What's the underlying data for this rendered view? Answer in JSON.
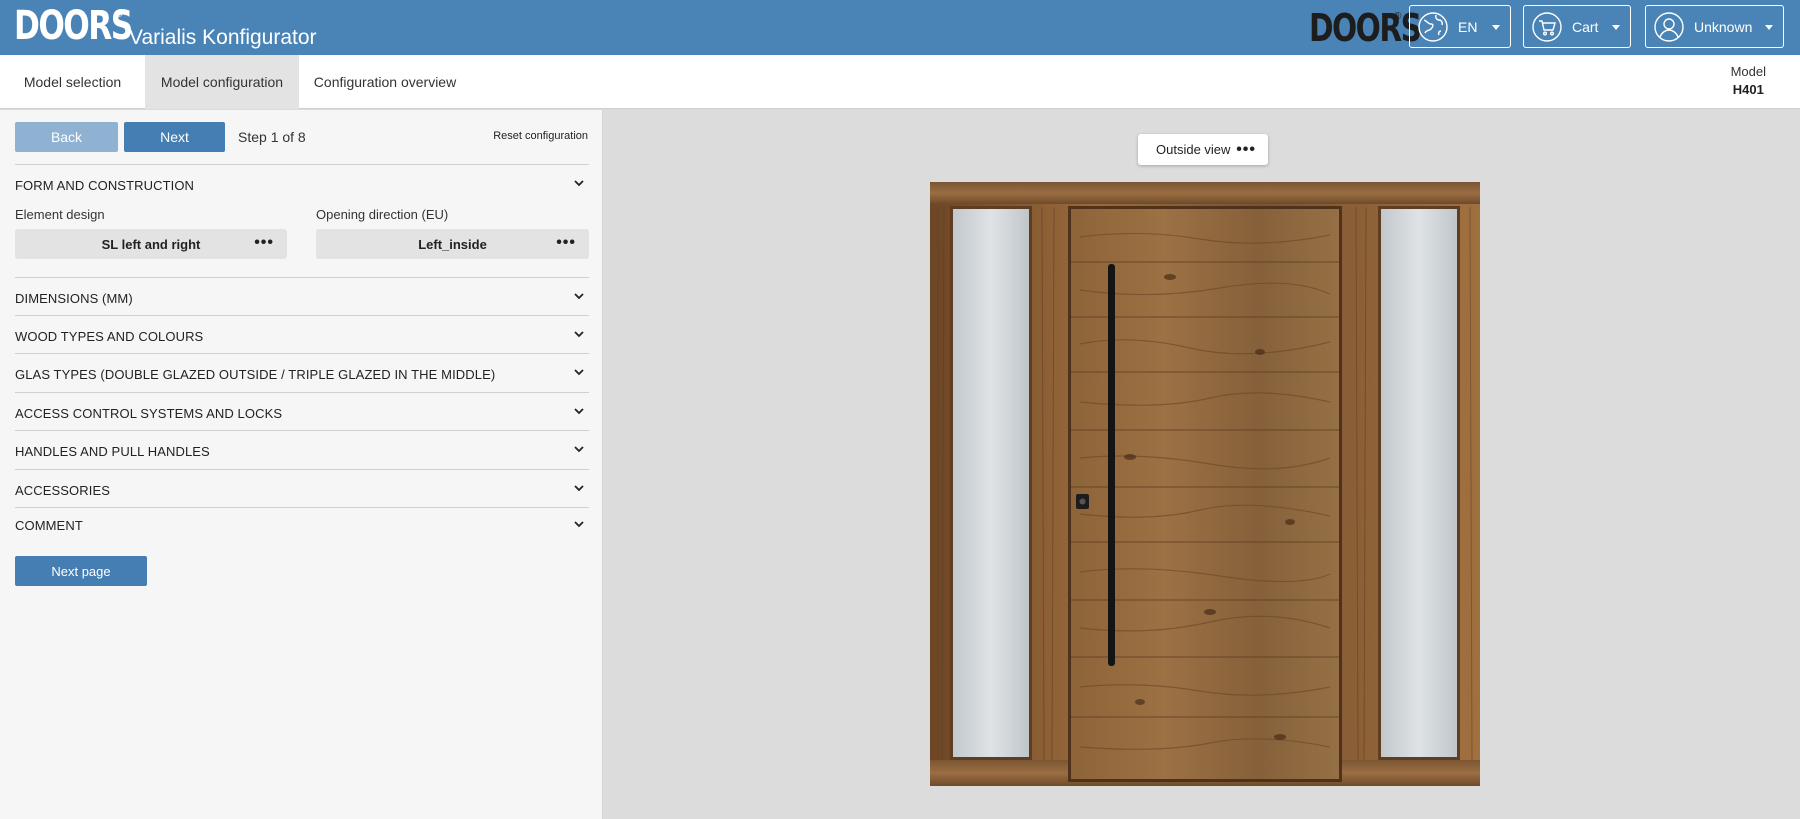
{
  "header": {
    "logo": "DOORS",
    "logo_mark": "®",
    "app_title": "Varialis Konfigurator",
    "brand_logo": "DOORS",
    "brand_mark": "®",
    "language": {
      "label": "EN",
      "icon": "globe-icon"
    },
    "cart": {
      "label": "Cart",
      "icon": "cart-icon"
    },
    "user": {
      "label": "Unknown",
      "icon": "user-icon"
    }
  },
  "nav": {
    "tabs": [
      {
        "label": "Model selection",
        "active": false
      },
      {
        "label": "Model configuration",
        "active": true
      },
      {
        "label": "Configuration overview",
        "active": false
      }
    ],
    "model": {
      "label": "Model",
      "value": "H401"
    }
  },
  "config": {
    "back_label": "Back",
    "next_label": "Next",
    "step_text": "Step 1 of 8",
    "reset_label": "Reset configuration",
    "sections": [
      "FORM AND CONSTRUCTION",
      "DIMENSIONS (MM)",
      "WOOD TYPES AND COLOURS",
      "GLAS TYPES (DOUBLE GLAZED OUTSIDE / TRIPLE GLAZED IN THE MIDDLE)",
      "ACCESS CONTROL SYSTEMS AND LOCKS",
      "HANDLES AND PULL HANDLES",
      "ACCESSORIES",
      "COMMENT"
    ],
    "element_design": {
      "label": "Element design",
      "value": "SL left and right"
    },
    "opening_direction": {
      "label": "Opening direction (EU)",
      "value": "Left_inside"
    },
    "next_page_label": "Next page",
    "dots": "•••"
  },
  "preview": {
    "view_label": "Outside view",
    "dots": "•••"
  },
  "colors": {
    "header_bg": "#4a84b7",
    "primary_button": "#447eb2",
    "disabled_button": "#8fb2d2",
    "wood_base": "#8a5f36",
    "glass": "#c9cfd3"
  }
}
